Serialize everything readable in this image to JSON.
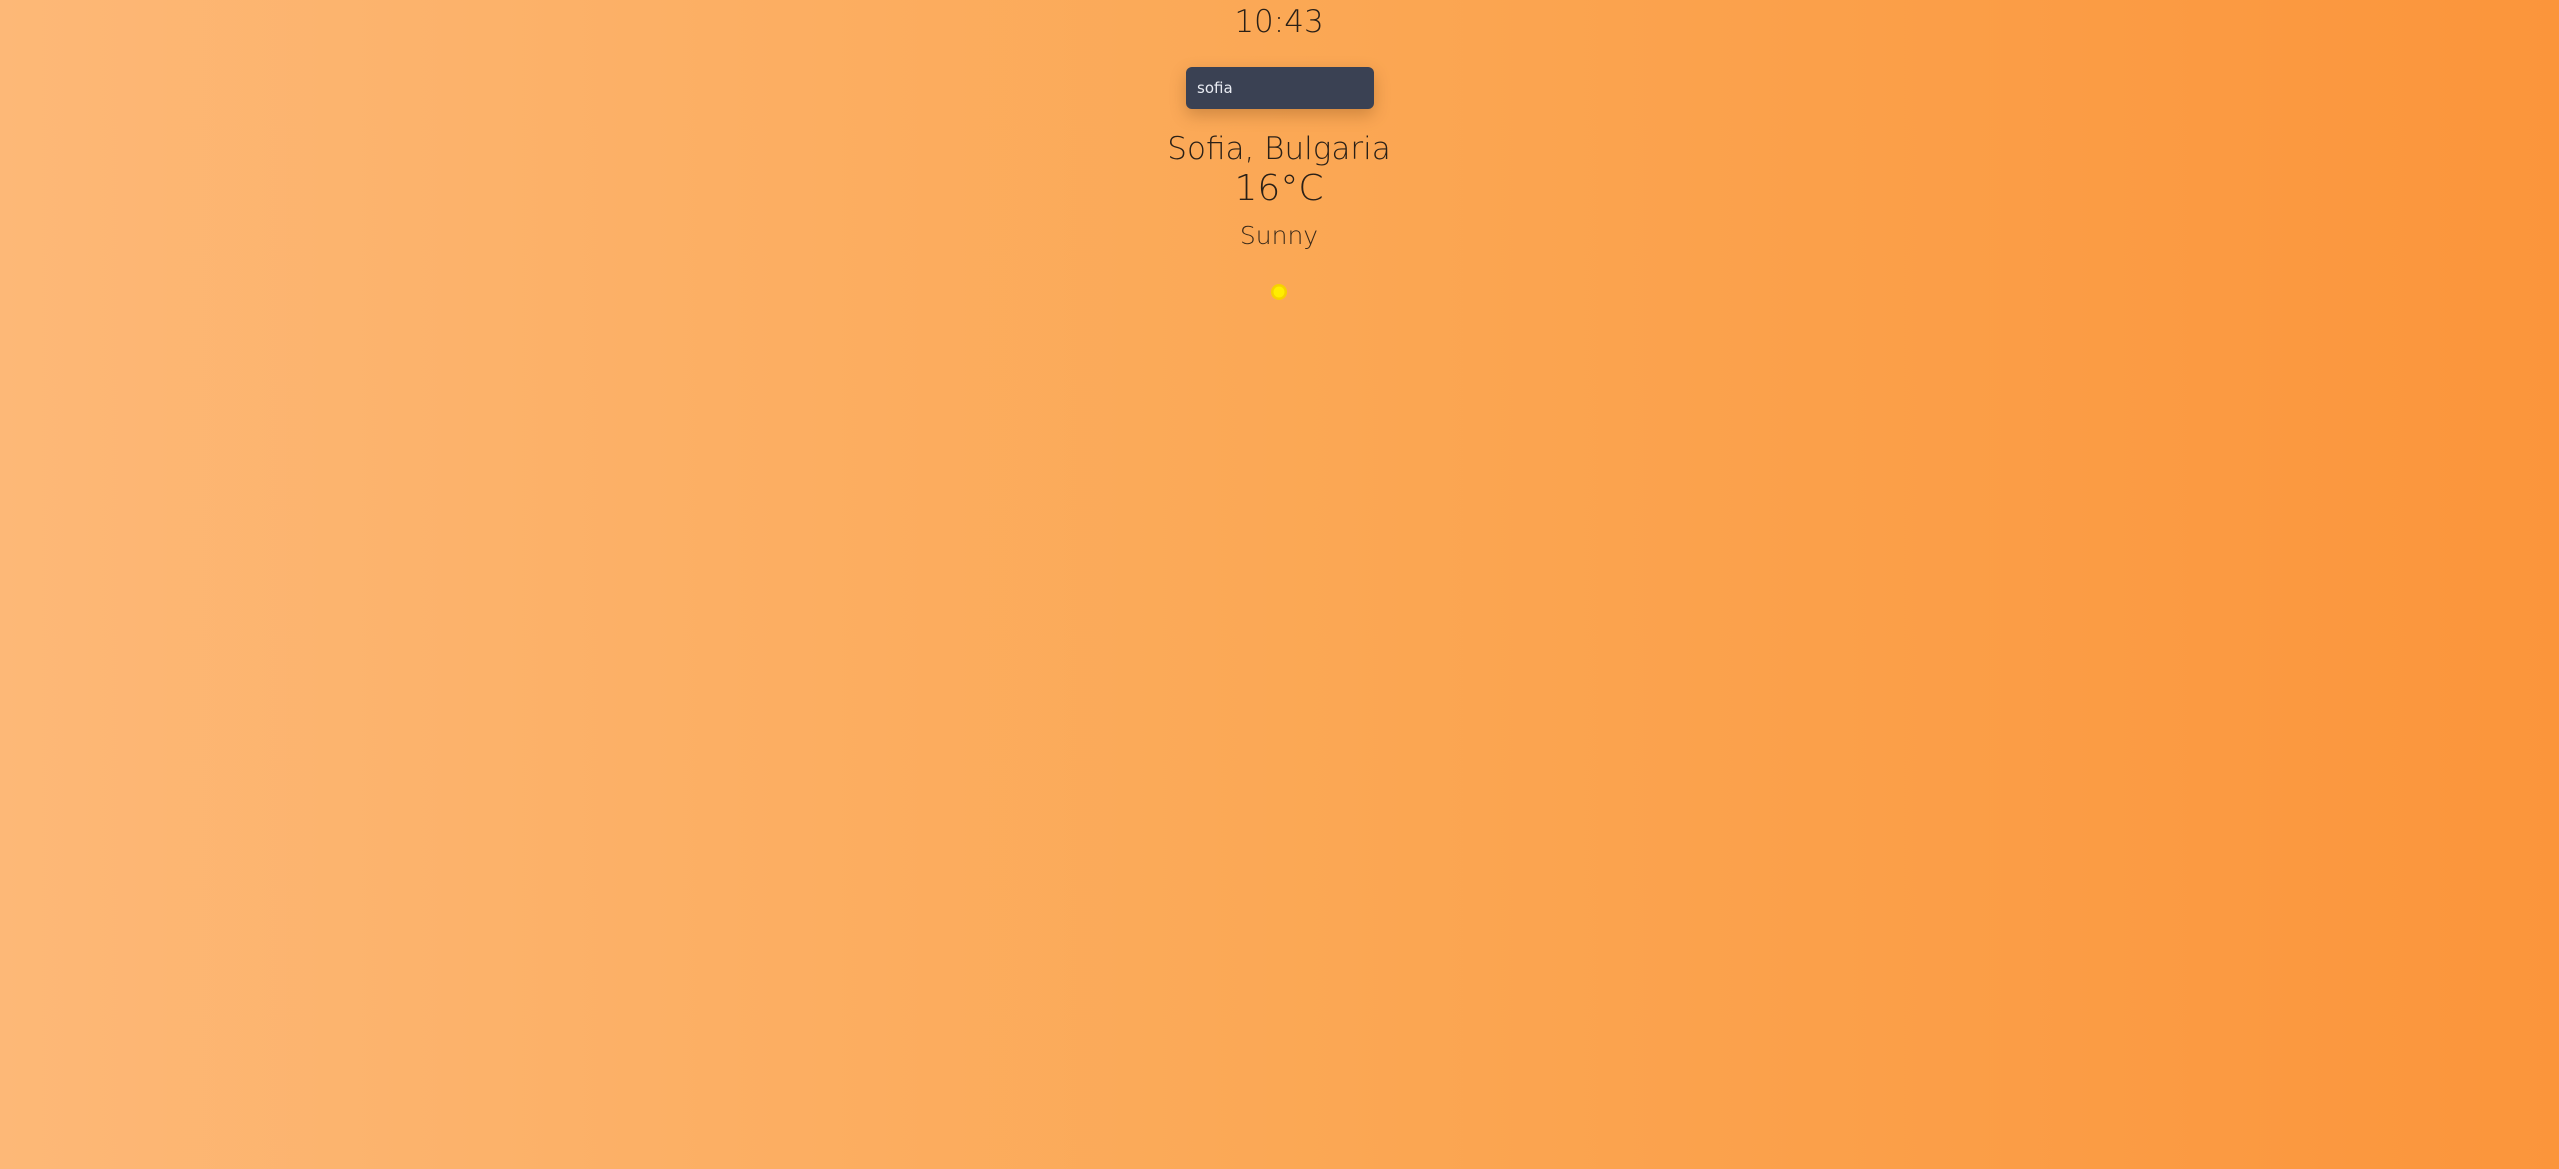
{
  "clock": {
    "time": "10:43"
  },
  "search": {
    "value": "sofia",
    "placeholder": ""
  },
  "weather": {
    "location": "Sofia, Bulgaria",
    "temperature": "16°C",
    "condition": "Sunny",
    "icon": "sun-icon"
  },
  "colors": {
    "background_left": "#fdb877",
    "background_right": "#fb953b",
    "search_bg": "#3a4153",
    "sun": "#ffee00"
  }
}
